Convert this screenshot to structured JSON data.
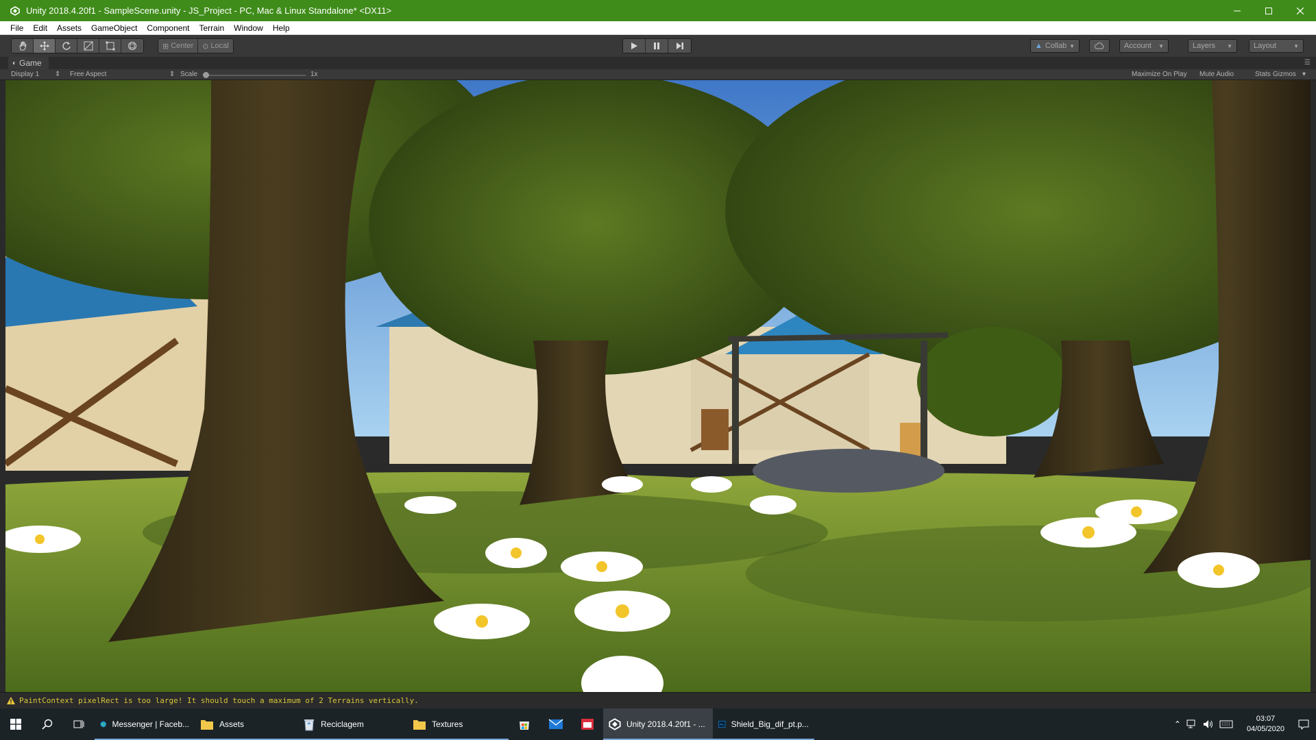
{
  "window": {
    "title": "Unity 2018.4.20f1 - SampleScene.unity - JS_Project - PC, Mac & Linux Standalone* <DX11>",
    "colors": {
      "titlebar": "#3f8c1a"
    }
  },
  "menu": {
    "items": [
      {
        "label": "File"
      },
      {
        "label": "Edit"
      },
      {
        "label": "Assets"
      },
      {
        "label": "GameObject"
      },
      {
        "label": "Component"
      },
      {
        "label": "Terrain"
      },
      {
        "label": "Window"
      },
      {
        "label": "Help"
      }
    ]
  },
  "toolbar": {
    "tools": [
      {
        "icon": "hand-tool-icon"
      },
      {
        "icon": "move-tool-icon"
      },
      {
        "icon": "rotate-tool-icon"
      },
      {
        "icon": "scale-tool-icon"
      },
      {
        "icon": "rect-tool-icon"
      },
      {
        "icon": "transform-tool-icon"
      }
    ],
    "pivot_center": "Center",
    "pivot_local": "Local",
    "collab": "Collab",
    "account": "Account",
    "layers": "Layers",
    "layout": "Layout"
  },
  "game": {
    "tab_label": "Game",
    "display": "Display 1",
    "aspect": "Free Aspect",
    "scale_label": "Scale",
    "scale_value": "1x",
    "maximize_on_play": "Maximize On Play",
    "mute_audio": "Mute Audio",
    "stats": "Stats",
    "gizmos": "Gizmos"
  },
  "console": {
    "message": "PaintContext pixelRect is too large!  It should touch a maximum of 2 Terrains vertically."
  },
  "taskbar": {
    "apps": [
      {
        "label": "Messenger | Faceb...",
        "icon": "edge-icon"
      },
      {
        "label": "Assets",
        "icon": "folder-icon"
      },
      {
        "label": "Reciclagem",
        "icon": "recycle-bin-icon"
      },
      {
        "label": "Textures",
        "icon": "folder-icon"
      }
    ],
    "unity_app": "Unity 2018.4.20f1 - ...",
    "ps_app": "Shield_Big_dif_pt.p...",
    "time": "03:07",
    "date": "04/05/2020"
  }
}
